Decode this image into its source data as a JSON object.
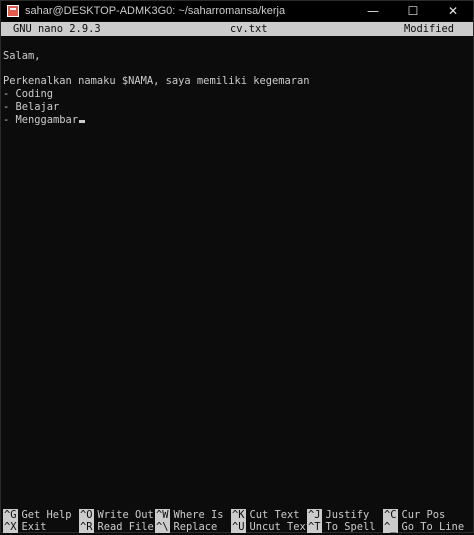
{
  "window": {
    "title": "sahar@DESKTOP-ADMK3G0: ~/saharromansa/kerja",
    "minimize_glyph": "—",
    "maximize_glyph": "☐",
    "close_glyph": "✕",
    "icon": "terminal-app-icon"
  },
  "nano": {
    "version": "GNU nano 2.9.3",
    "filename": "cv.txt",
    "status": "Modified"
  },
  "editor": {
    "lines": [
      "",
      "Salam,",
      "",
      "Perkenalkan namaku $NAMA, saya memiliki kegemaran",
      "- Coding",
      "- Belajar",
      "- Menggambar"
    ]
  },
  "shortcuts": {
    "row1": [
      {
        "key": "^G",
        "label": "Get Help"
      },
      {
        "key": "^O",
        "label": "Write Out"
      },
      {
        "key": "^W",
        "label": "Where Is"
      },
      {
        "key": "^K",
        "label": "Cut Text"
      },
      {
        "key": "^J",
        "label": "Justify"
      },
      {
        "key": "^C",
        "label": "Cur Pos"
      }
    ],
    "row2": [
      {
        "key": "^X",
        "label": "Exit"
      },
      {
        "key": "^R",
        "label": "Read File"
      },
      {
        "key": "^\\",
        "label": "Replace"
      },
      {
        "key": "^U",
        "label": "Uncut Text"
      },
      {
        "key": "^T",
        "label": "To Spell"
      },
      {
        "key": "^_",
        "label": "Go To Line"
      }
    ]
  },
  "colors": {
    "background": "#0c0c0c",
    "foreground": "#cccccc",
    "titlebar": "#000000",
    "app_icon": "#e05a4e"
  }
}
